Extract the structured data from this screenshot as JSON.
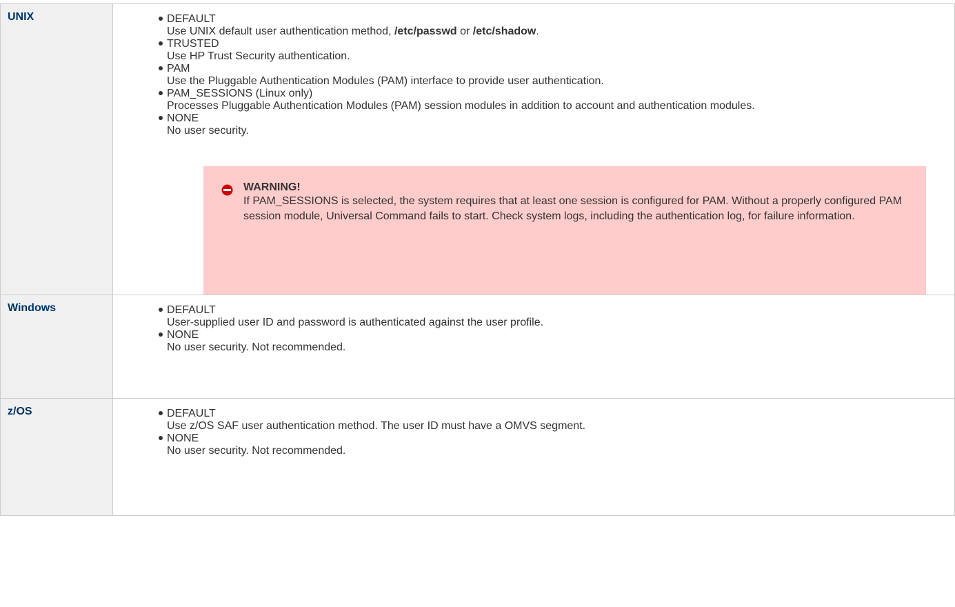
{
  "rows": [
    {
      "header": "UNIX",
      "options": [
        {
          "name": "DEFAULT",
          "desc_pre": "Use UNIX default user authentication method, ",
          "desc_b1": "/etc/passwd",
          "desc_mid": " or ",
          "desc_b2": "/etc/shadow",
          "desc_post": "."
        },
        {
          "name": "TRUSTED",
          "desc": "Use HP Trust Security authentication."
        },
        {
          "name": "PAM",
          "desc": "Use the Pluggable Authentication Modules (PAM) interface to provide user authentication."
        },
        {
          "name": "PAM_SESSIONS (Linux only)",
          "desc": "Processes Pluggable Authentication Modules (PAM) session modules in addition to account and authentication modules."
        },
        {
          "name": "NONE",
          "desc": "No user security."
        }
      ],
      "warning": {
        "title": "WARNING!",
        "text": "If PAM_SESSIONS is selected, the system requires that at least one session is configured for PAM. Without a properly configured PAM session module, Universal Command fails to start. Check system logs, including the authentication log, for failure information.",
        "icon": "stop-icon",
        "color": "#ffcccc"
      }
    },
    {
      "header": "Windows",
      "options": [
        {
          "name": "DEFAULT",
          "desc": "User-supplied user ID and password is authenticated against the user profile."
        },
        {
          "name": "NONE",
          "desc": "No user security. Not recommended."
        }
      ]
    },
    {
      "header": "z/OS",
      "options": [
        {
          "name": "DEFAULT",
          "desc": "Use z/OS SAF user authentication method. The user ID must have a OMVS segment."
        },
        {
          "name": "NONE",
          "desc": "No user security. Not recommended."
        }
      ]
    }
  ],
  "colors": {
    "header_text": "#003366",
    "header_bg": "#f0f0f0",
    "border": "#cccccc",
    "warning_bg": "#ffcccc",
    "warning_icon": "#cc0000"
  }
}
